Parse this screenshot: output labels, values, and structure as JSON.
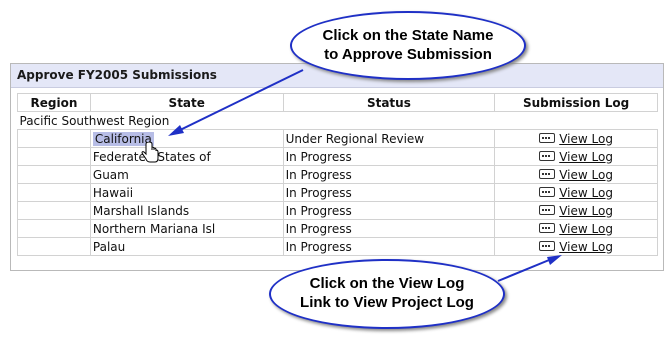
{
  "panel": {
    "title": "Approve FY2005 Submissions"
  },
  "table": {
    "headers": [
      "Region",
      "State",
      "Status",
      "Submission Log"
    ],
    "region_name": "Pacific Southwest Region",
    "rows": [
      {
        "state": "California",
        "status": "Under Regional Review",
        "log": "View Log"
      },
      {
        "state": "Federated States of",
        "status": "In Progress",
        "log": "View Log"
      },
      {
        "state": "Guam",
        "status": "In Progress",
        "log": "View Log"
      },
      {
        "state": "Hawaii",
        "status": "In Progress",
        "log": "View Log"
      },
      {
        "state": "Marshall Islands",
        "status": "In Progress",
        "log": "View Log"
      },
      {
        "state": "Northern Mariana Isl",
        "status": "In Progress",
        "log": "View Log"
      },
      {
        "state": "Palau",
        "status": "In Progress",
        "log": "View Log"
      }
    ]
  },
  "callouts": {
    "top_line1": "Click on the State Name",
    "top_line2": "to Approve Submission",
    "bottom_line1": "Click on the View Log",
    "bottom_line2": "Link to View Project Log"
  },
  "colors": {
    "highlight": "#b7bde6",
    "callout_border": "#1f30c6",
    "title_bg": "#e4e7f7"
  },
  "icons": {
    "log": "log-icon",
    "cursor": "hand-pointer-icon"
  }
}
